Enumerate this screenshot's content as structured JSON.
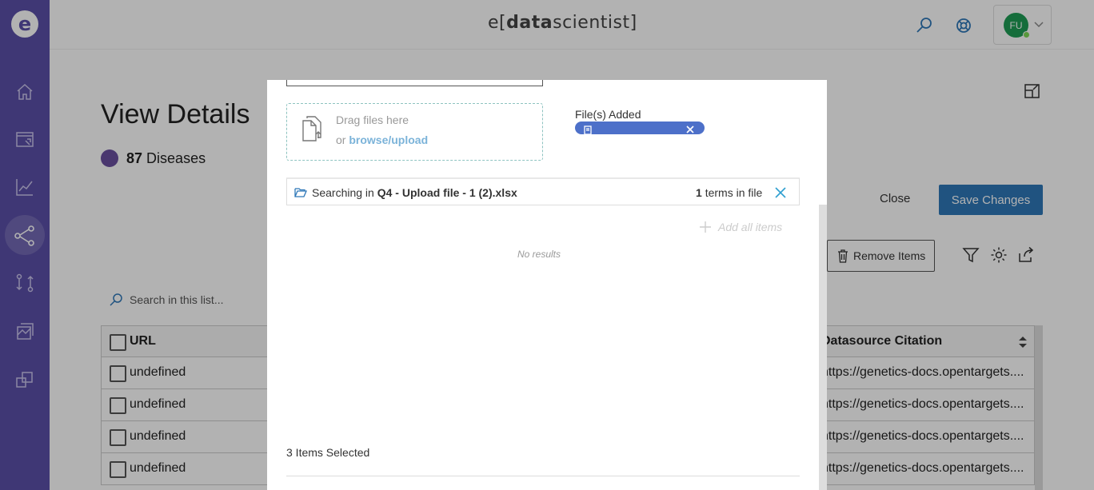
{
  "brand": {
    "prefix": "e",
    "open": "[",
    "data": "data",
    "rest": "scientist",
    "close": "]"
  },
  "user": {
    "initials": "FU"
  },
  "page": {
    "title": "View Details",
    "count": "87",
    "count_label": "Diseases"
  },
  "actions": {
    "close": "Close",
    "save": "Save Changes",
    "remove": "Remove Items"
  },
  "search_list": {
    "placeholder": "Search in this list..."
  },
  "table": {
    "headers": {
      "url": "URL",
      "citation": "Datasource Citation"
    },
    "rows": [
      {
        "url": "undefined",
        "citation": "https://genetics-docs.opentargets...."
      },
      {
        "url": "undefined",
        "citation": "https://genetics-docs.opentargets...."
      },
      {
        "url": "undefined",
        "citation": "https://genetics-docs.opentargets...."
      },
      {
        "url": "undefined",
        "citation": "https://genetics-docs.opentargets...."
      }
    ]
  },
  "modal": {
    "dropzone": {
      "line1": "Drag files here",
      "or": "or",
      "link": "browse/upload"
    },
    "files_added_label": "File(s) Added",
    "search": {
      "prefix": "Searching in",
      "file": "Q4 - Upload file - 1 (2).xlsx",
      "count": "1",
      "count_suffix": "terms in file"
    },
    "add_all": "Add all items",
    "no_results": "No results",
    "items_selected": "3 Items Selected"
  },
  "colors": {
    "sidebar": "#5b4fa8",
    "accent": "#2f78b8",
    "chip": "#4d70c9",
    "avatar": "#1f9d55"
  }
}
